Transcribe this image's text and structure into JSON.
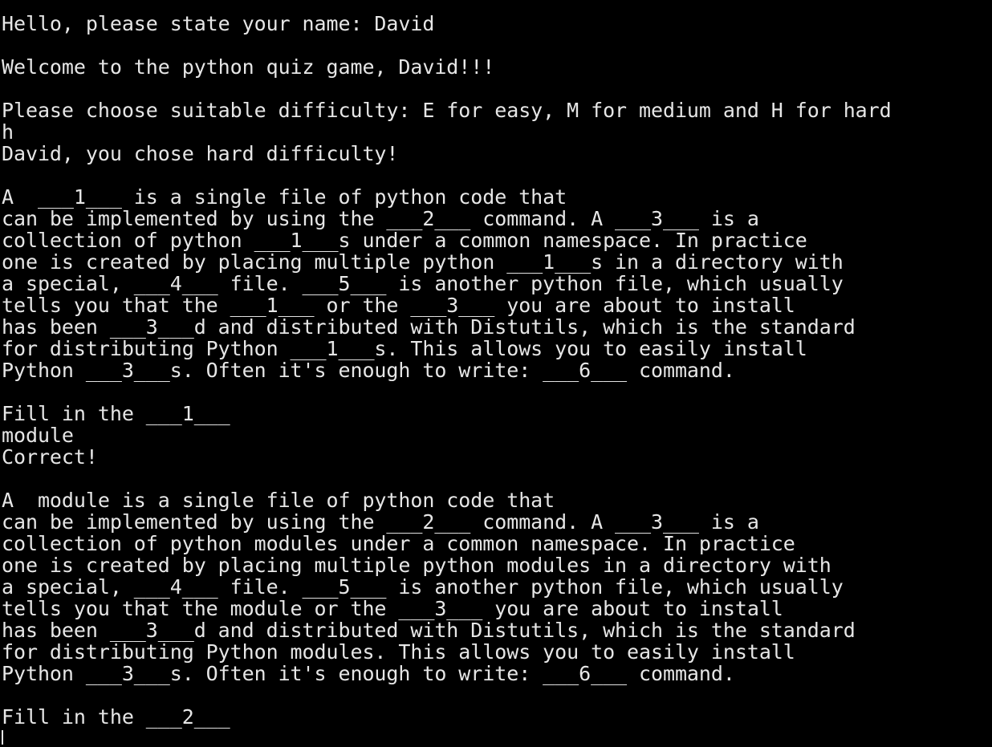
{
  "terminal": {
    "lines": [
      "Hello, please state your name: David",
      "",
      "Welcome to the python quiz game, David!!!",
      "",
      "Please choose suitable difficulty: E for easy, M for medium and H for hard",
      "h",
      "David, you chose hard difficulty!",
      "",
      "A  ___1___ is a single file of python code that",
      "can be implemented by using the ___2___ command. A ___3___ is a",
      "collection of python ___1___s under a common namespace. In practice",
      "one is created by placing multiple python ___1___s in a directory with",
      "a special, ___4___ file. ___5___ is another python file, which usually",
      "tells you that the ___1___ or the ___3___ you are about to install",
      "has been ___3___d and distributed with Distutils, which is the standard",
      "for distributing Python ___1___s. This allows you to easily install",
      "Python ___3___s. Often it's enough to write: ___6___ command.",
      "",
      "Fill in the ___1___",
      "module",
      "Correct!",
      "",
      "A  module is a single file of python code that",
      "can be implemented by using the ___2___ command. A ___3___ is a",
      "collection of python modules under a common namespace. In practice",
      "one is created by placing multiple python modules in a directory with",
      "a special, ___4___ file. ___5___ is another python file, which usually",
      "tells you that the module or the ___3___ you are about to install",
      "has been ___3___d and distributed with Distutils, which is the standard",
      "for distributing Python modules. This allows you to easily install",
      "Python ___3___s. Often it's enough to write: ___6___ command.",
      "",
      "Fill in the ___2___"
    ]
  },
  "colors": {
    "background": "#000000",
    "foreground": "#e6e6e6"
  }
}
